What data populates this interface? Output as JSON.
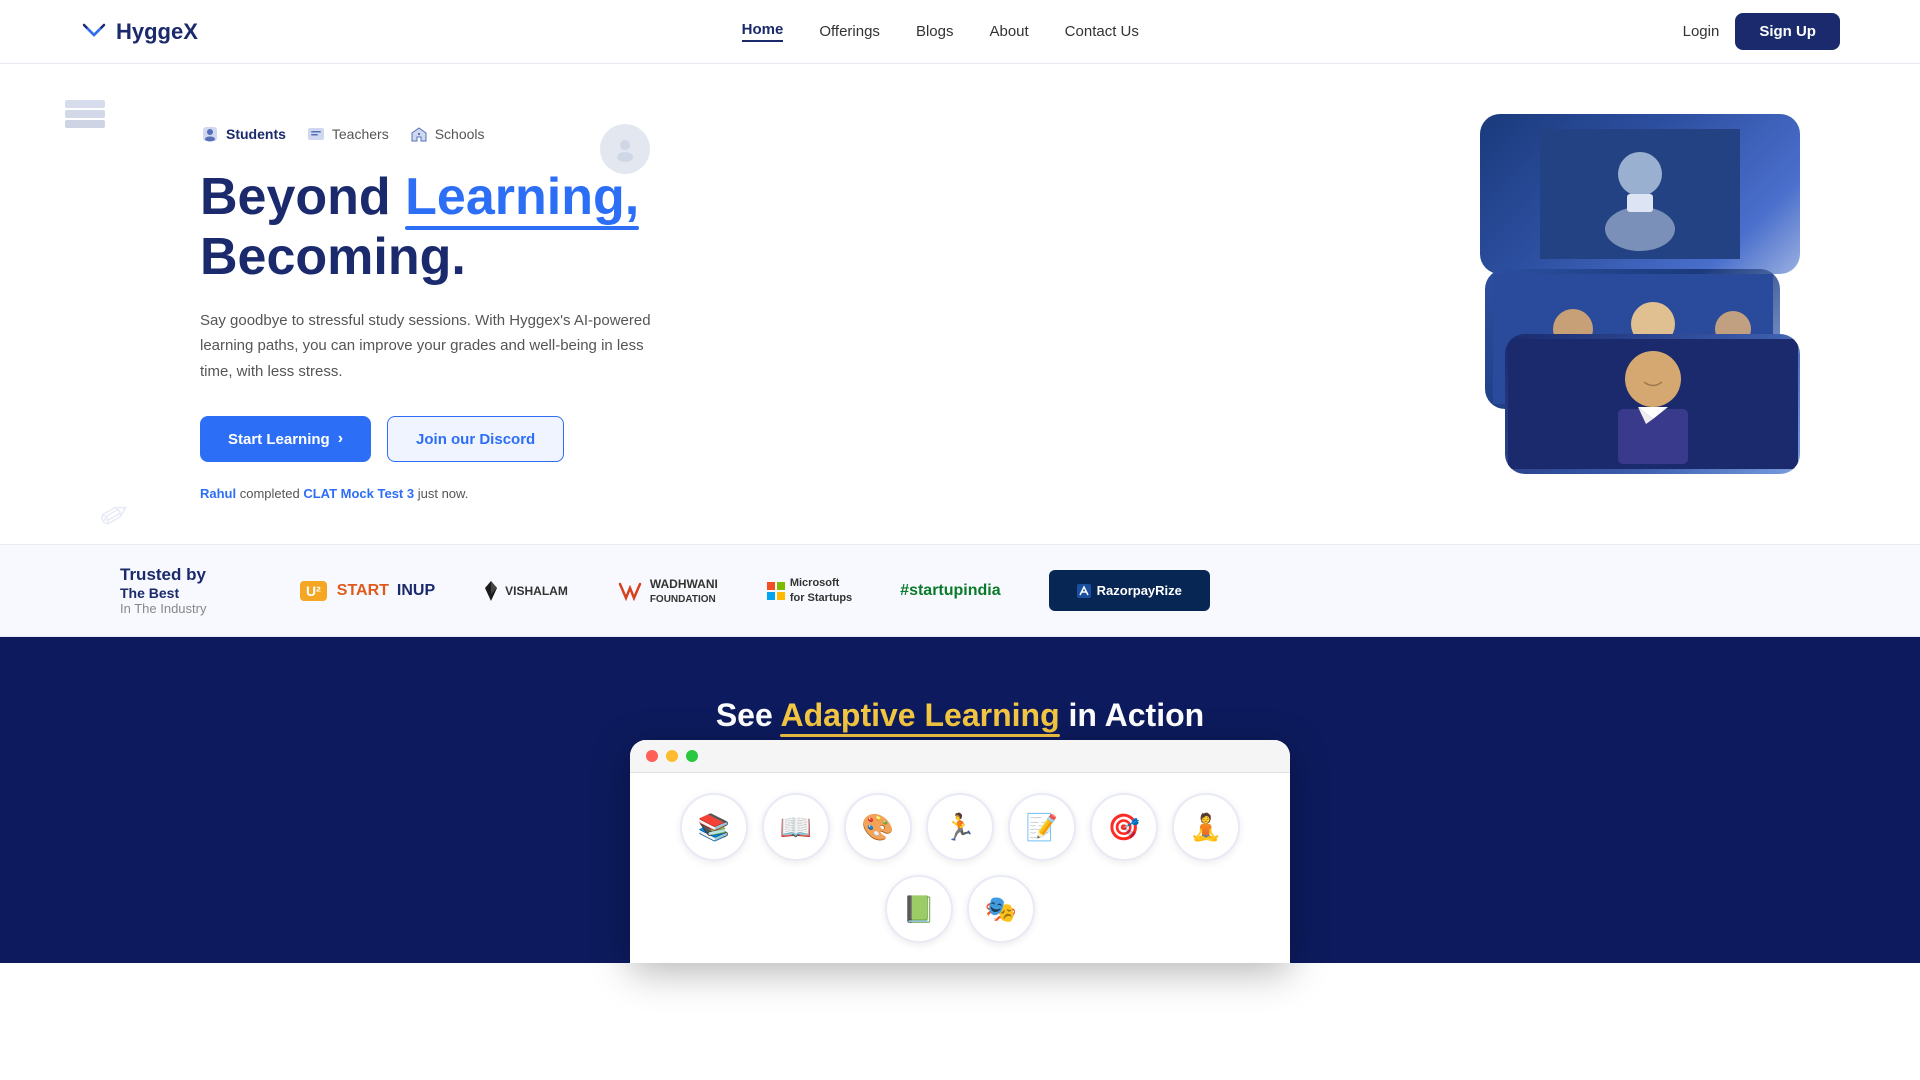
{
  "brand": {
    "name": "HyggeX",
    "logo_symbol": "✦"
  },
  "nav": {
    "links": [
      {
        "label": "Home",
        "active": true
      },
      {
        "label": "Offerings",
        "active": false
      },
      {
        "label": "Blogs",
        "active": false
      },
      {
        "label": "About",
        "active": false
      },
      {
        "label": "Contact Us",
        "active": false
      }
    ],
    "login_label": "Login",
    "signup_label": "Sign Up"
  },
  "hero": {
    "tabs": [
      {
        "label": "Students",
        "icon": "👤"
      },
      {
        "label": "Teachers",
        "icon": "📋"
      },
      {
        "label": "Schools",
        "icon": "🏫"
      }
    ],
    "title_part1": "Beyond ",
    "title_highlight": "Learning,",
    "title_part2": "Becoming.",
    "description": "Say goodbye to stressful study sessions. With Hyggex's AI-powered learning paths, you can improve your grades and well-being in less time, with less stress.",
    "btn_start": "Start Learning",
    "btn_discord": "Join our Discord",
    "activity_name": "Rahul",
    "activity_text": " completed ",
    "activity_test": "CLAT Mock Test 3",
    "activity_suffix": " just now."
  },
  "trusted": {
    "label_line1": "Trusted by",
    "label_line2": "The Best",
    "label_line3": "In The Industry",
    "logos": [
      {
        "name": "StartInUp",
        "display": "U² START INUP"
      },
      {
        "name": "Vishalam",
        "display": "VISHALAM"
      },
      {
        "name": "Wadhwani Foundation",
        "display": "WADHWANI FOUNDATION"
      },
      {
        "name": "Microsoft for Startups",
        "display": "Microsoft for Startups"
      },
      {
        "name": "startupindia",
        "display": "#startupindia"
      },
      {
        "name": "RazorpayRize",
        "display": "≡ RazorpayRize"
      }
    ]
  },
  "adaptive": {
    "title_part1": "See ",
    "title_highlight": "Adaptive Learning",
    "title_part2": " in Action",
    "browser_icons": [
      "📚",
      "📖",
      "🎨",
      "🏃",
      "📝",
      "🎯",
      "🧘",
      "📗",
      "🎭"
    ]
  }
}
